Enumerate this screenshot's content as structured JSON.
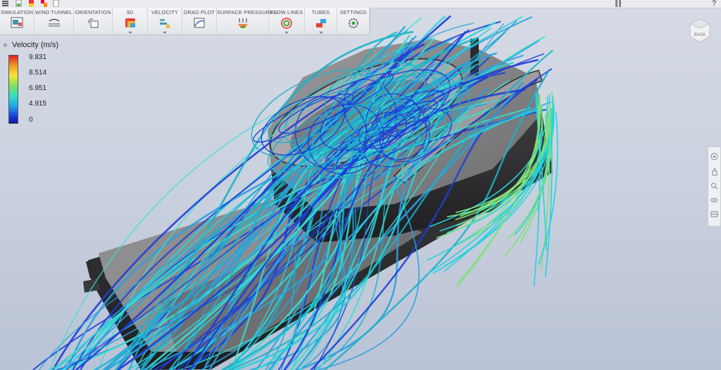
{
  "ribbon": {
    "tabs": [
      {
        "label": "SIMULATION",
        "icon": "simulation-icon",
        "has_menu": false,
        "width": 49
      },
      {
        "label": "WIND TUNNEL",
        "icon": "wind-tunnel-icon",
        "has_menu": false,
        "width": 56
      },
      {
        "label": "ORIENTATION",
        "icon": "orientation-icon",
        "has_menu": false,
        "width": 55
      },
      {
        "label": "3D",
        "icon": "3d-icon",
        "has_menu": true,
        "width": 50
      },
      {
        "label": "VELOCITY",
        "icon": "velocity-icon",
        "has_menu": true,
        "width": 49
      },
      {
        "label": "DRAG PLOT",
        "icon": "drag-plot-icon",
        "has_menu": false,
        "width": 49
      },
      {
        "label": "SURFACE PRESSURES",
        "icon": "surface-pressures-icon",
        "has_menu": false,
        "width": 74
      },
      {
        "label": "FLOW LINES",
        "icon": "flow-lines-icon",
        "has_menu": true,
        "width": 51
      },
      {
        "label": "TUBES",
        "icon": "tubes-icon",
        "has_menu": true,
        "width": 46
      },
      {
        "label": "SETTINGS",
        "icon": "settings-icon",
        "has_menu": false,
        "width": 46
      }
    ]
  },
  "legend": {
    "title": "Velocity (m/s)",
    "ticks": [
      "9.831",
      "8.514",
      "6.951",
      "4.915",
      "0"
    ]
  },
  "viewcube": {
    "label": "BACK"
  },
  "colors": {
    "flow_cyan": "#27d2dc",
    "flow_blue": "#1d3ed6",
    "flow_teal": "#19b2c8",
    "model_gray": "#7a7a7c"
  }
}
